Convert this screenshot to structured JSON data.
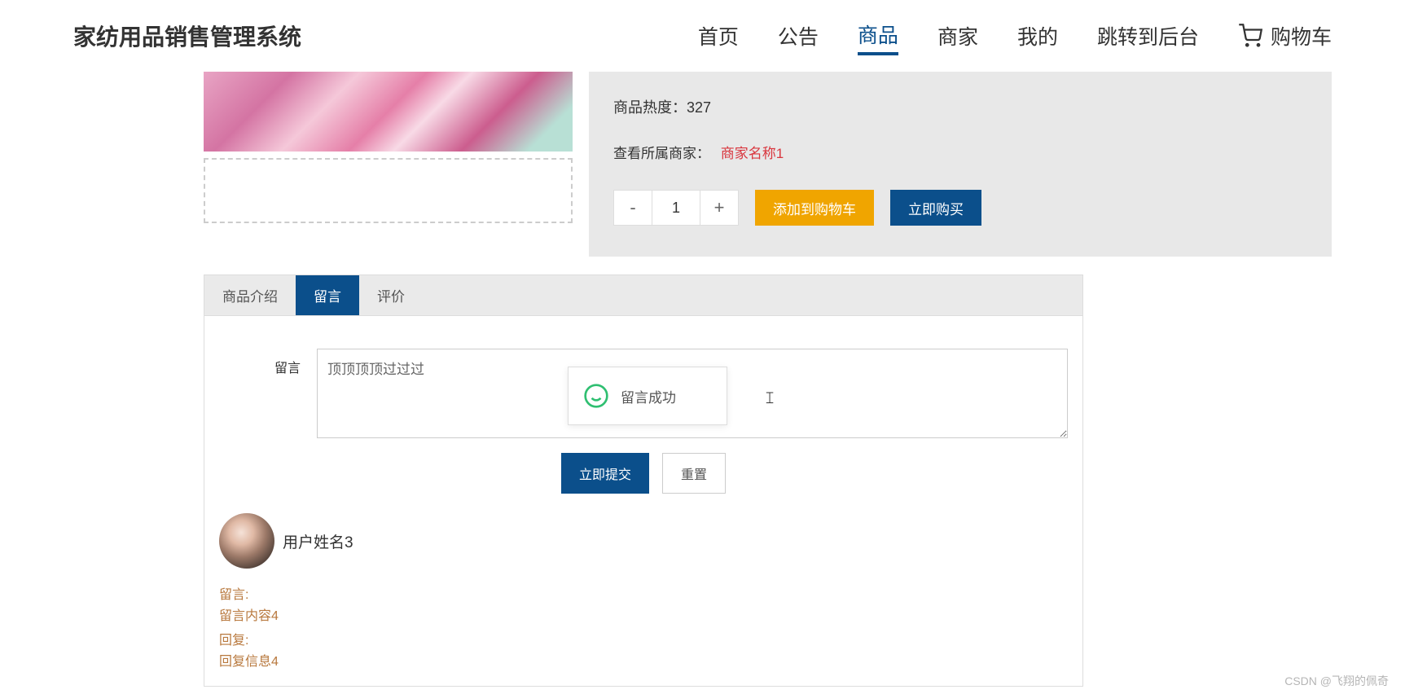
{
  "header": {
    "site_title": "家纺用品销售管理系统",
    "nav": [
      {
        "label": "首页",
        "active": false
      },
      {
        "label": "公告",
        "active": false
      },
      {
        "label": "商品",
        "active": true
      },
      {
        "label": "商家",
        "active": false
      },
      {
        "label": "我的",
        "active": false
      },
      {
        "label": "跳转到后台",
        "active": false
      }
    ],
    "cart_label": "购物车"
  },
  "product": {
    "heat_label": "商品热度：",
    "heat_value": "327",
    "merchant_label": "查看所属商家：",
    "merchant_name": "商家名称1",
    "quantity": "1",
    "minus": "-",
    "plus": "+",
    "add_cart_label": "添加到购物车",
    "buy_now_label": "立即购买"
  },
  "tabs": {
    "items": [
      {
        "label": "商品介绍"
      },
      {
        "label": "留言"
      },
      {
        "label": "评价"
      }
    ],
    "active_index": 1
  },
  "message_form": {
    "label": "留言",
    "textarea_value": "顶顶顶顶过过过",
    "submit_label": "立即提交",
    "reset_label": "重置"
  },
  "toast": {
    "text": "留言成功"
  },
  "comment": {
    "username": "用户姓名3",
    "msg_label": "留言:",
    "msg_text": "留言内容4",
    "reply_label": "回复:",
    "reply_text": "回复信息4"
  },
  "watermark": "CSDN @飞翔的佩奇"
}
